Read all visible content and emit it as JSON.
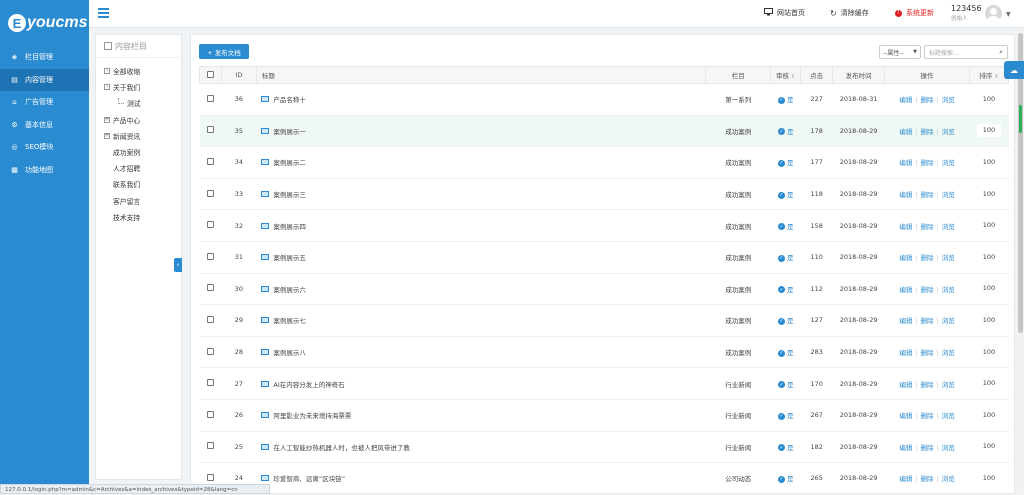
{
  "brand": {
    "logo_e": "E",
    "logo_text": "youcms"
  },
  "sidebar": {
    "items": [
      {
        "label": "栏目管理",
        "icon": "layers-icon"
      },
      {
        "label": "内容管理",
        "icon": "document-icon",
        "active": true
      },
      {
        "label": "广告管理",
        "icon": "ad-icon"
      },
      {
        "label": "基本信息",
        "icon": "gear-icon"
      },
      {
        "label": "SEO模块",
        "icon": "globe-icon"
      },
      {
        "label": "功能地图",
        "icon": "grid-icon"
      }
    ]
  },
  "topbar": {
    "site_home": "网站首页",
    "clear_cache": "清除缓存",
    "system_update": "系统更新",
    "username": "123456",
    "role": "创始人"
  },
  "tree": {
    "header": "内容栏目",
    "items": [
      {
        "label": "全部收缩",
        "prefix": "-",
        "level": 0
      },
      {
        "label": "关于我们",
        "prefix": "-",
        "level": 0
      },
      {
        "label": "测试",
        "prefix": "",
        "level": 1
      },
      {
        "label": "产品中心",
        "prefix": "+",
        "level": 0
      },
      {
        "label": "新闻资讯",
        "prefix": "+",
        "level": 0
      },
      {
        "label": "成功案例",
        "prefix": "",
        "level": 0
      },
      {
        "label": "人才招聘",
        "prefix": "",
        "level": 0
      },
      {
        "label": "联系我们",
        "prefix": "",
        "level": 0
      },
      {
        "label": "客户留言",
        "prefix": "",
        "level": 0
      },
      {
        "label": "技术支持",
        "prefix": "",
        "level": 0
      }
    ]
  },
  "toolbar": {
    "publish_label": "+ 发布文档",
    "filter_value": "--属性--",
    "search_placeholder": "标题搜索..."
  },
  "table": {
    "headers": {
      "id": "ID",
      "title": "标题",
      "column": "栏目",
      "audit": "审核",
      "clicks": "点击",
      "time": "发布时间",
      "ops": "操作",
      "sort": "排序"
    },
    "ops": {
      "edit": "编辑",
      "delete": "删除",
      "view": "浏览"
    },
    "audit_text": "是",
    "rows": [
      {
        "id": "36",
        "title": "产品名称十",
        "column": "第一系列",
        "clicks": "227",
        "time": "2018-08-31",
        "sort": "100"
      },
      {
        "id": "35",
        "title": "案例展示一",
        "column": "成功案例",
        "clicks": "178",
        "time": "2018-08-29",
        "sort": "100"
      },
      {
        "id": "34",
        "title": "案例展示二",
        "column": "成功案例",
        "clicks": "177",
        "time": "2018-08-29",
        "sort": "100"
      },
      {
        "id": "33",
        "title": "案例展示三",
        "column": "成功案例",
        "clicks": "118",
        "time": "2018-08-29",
        "sort": "100"
      },
      {
        "id": "32",
        "title": "案例展示四",
        "column": "成功案例",
        "clicks": "158",
        "time": "2018-08-29",
        "sort": "100"
      },
      {
        "id": "31",
        "title": "案例展示五",
        "column": "成功案例",
        "clicks": "110",
        "time": "2018-08-29",
        "sort": "100"
      },
      {
        "id": "30",
        "title": "案例展示六",
        "column": "成功案例",
        "clicks": "112",
        "time": "2018-08-29",
        "sort": "100"
      },
      {
        "id": "29",
        "title": "案例展示七",
        "column": "成功案例",
        "clicks": "127",
        "time": "2018-08-29",
        "sort": "100"
      },
      {
        "id": "28",
        "title": "案例展示八",
        "column": "成功案例",
        "clicks": "283",
        "time": "2018-08-29",
        "sort": "100"
      },
      {
        "id": "27",
        "title": "AI在内容分发上的神奇石",
        "column": "行业新闻",
        "clicks": "170",
        "time": "2018-08-29",
        "sort": "100"
      },
      {
        "id": "26",
        "title": "阿里影业为未来增持海票票",
        "column": "行业新闻",
        "clicks": "267",
        "time": "2018-08-29",
        "sort": "100"
      },
      {
        "id": "25",
        "title": "在人工智能炒热机器人时，也被人把风带进了教",
        "column": "行业新闻",
        "clicks": "182",
        "time": "2018-08-29",
        "sort": "100"
      },
      {
        "id": "24",
        "title": "珍爱智商、远离“区块链”",
        "column": "公司动态",
        "clicks": "265",
        "time": "2018-08-29",
        "sort": "100"
      }
    ]
  },
  "status_url": "127.0.0.1/login.php?m=admin&c=Archives&a=index_archives&typeid=28&lang=cn",
  "colors": {
    "accent": "#2a8bd0",
    "sidebar_bg": "#2a8bd0",
    "alert": "#e02020",
    "row_highlight": "#eff8f3"
  }
}
